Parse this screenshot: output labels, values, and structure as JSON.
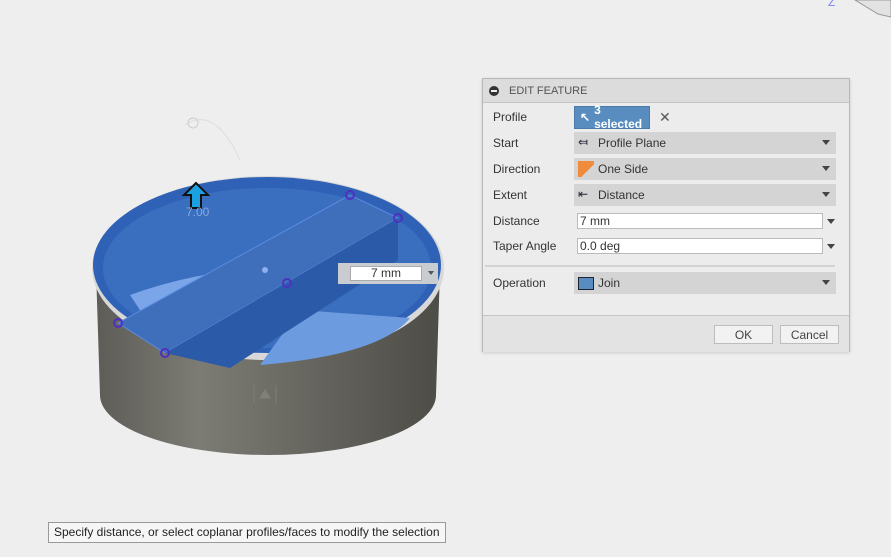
{
  "viewcube": {
    "axis_label": "Z"
  },
  "canvas": {
    "manipulator_value": "7.00",
    "distance_input": "7 mm"
  },
  "dialog": {
    "title": "EDIT FEATURE",
    "profile": {
      "label": "Profile",
      "value": "3 selected"
    },
    "start": {
      "label": "Start",
      "value": "Profile Plane"
    },
    "direction": {
      "label": "Direction",
      "value": "One Side"
    },
    "extent": {
      "label": "Extent",
      "value": "Distance"
    },
    "distance": {
      "label": "Distance",
      "value": "7 mm"
    },
    "taper": {
      "label": "Taper Angle",
      "value": "0.0 deg"
    },
    "operation": {
      "label": "Operation",
      "value": "Join"
    },
    "ok_label": "OK",
    "cancel_label": "Cancel"
  },
  "tooltip": "Specify distance, or select coplanar profiles/faces to modify the selection",
  "colors": {
    "selection": "#2e63b8",
    "body": "#6b6a63",
    "accent": "#5a8dbf"
  }
}
